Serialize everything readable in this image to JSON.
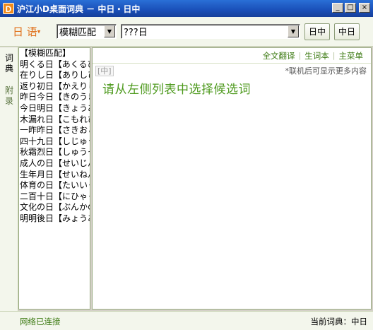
{
  "window": {
    "title": "沪江小D桌面词典 － 中日・日中",
    "icon_letter": "D",
    "minimize": "_",
    "maximize": "□",
    "close": "×"
  },
  "toolbar": {
    "language": "日 语",
    "language_arrow": "▾",
    "mode_value": "模糊匹配",
    "search_value": "???日",
    "drop_arrow": "▼",
    "btn_jc": "日中",
    "btn_cj": "中日"
  },
  "tabs": {
    "dict": "词典",
    "appendix": "附录"
  },
  "list": {
    "items": [
      "【模糊匹配】",
      "明くる日【あくるひ】",
      "在りし日【ありしひ】",
      "返り初日【かえりしょにち】",
      "昨日今日【きのうきょう】",
      "今日明日【きょうあす】",
      "木漏れ日【こもれび】",
      "一昨昨日【さきおととい】",
      "四十九日【しじゅうくにち】",
      "秋霜烈日【しゅうそうれつじつ】",
      "成人の日【せいじんのひ】",
      "生年月日【せいねんがっぴ】",
      "体育の日【たいいくのひ】",
      "二百十日【にひゃくとおか】",
      "文化の日【ぶんかのひ】",
      "明明後日【みょうあさって】"
    ]
  },
  "right": {
    "link_translate": "全文翻译",
    "link_vocab": "生词本",
    "link_menu": "主菜单",
    "tag": "[中]",
    "hint": "*联机后可显示更多内容",
    "prompt": "请从左侧列表中选择候选词"
  },
  "status": {
    "network": "网络已连接",
    "current_word": "当前词典：中日"
  }
}
